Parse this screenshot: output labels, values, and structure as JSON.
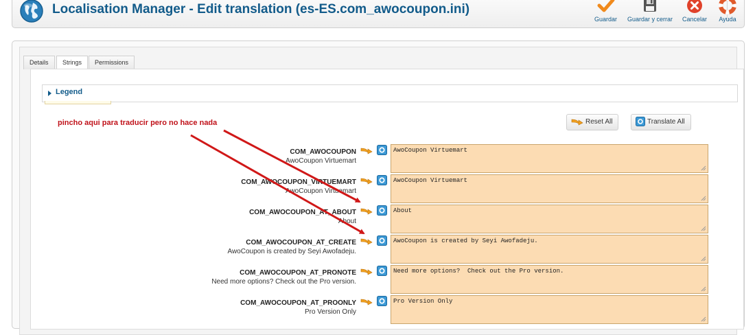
{
  "header": {
    "title": "Localisation Manager - Edit translation (es-ES.com_awocoupon.ini)",
    "logo_icon": "globe-icon"
  },
  "toolbar": {
    "save_label": "Guardar",
    "save_close_label": "Guardar y cerrar",
    "cancel_label": "Cancelar",
    "help_label": "Ayuda",
    "icons": [
      "checkmark-icon",
      "save-disk-icon",
      "cancel-x-icon",
      "help-lifebuoy-icon"
    ]
  },
  "tabs": [
    {
      "label": "Details"
    },
    {
      "label": "Strings",
      "active": true
    },
    {
      "label": "Permissions"
    }
  ],
  "legend": {
    "label": "Legend"
  },
  "annotation": "pincho aqui para traducir pero no hace nada",
  "actions": {
    "reset_all": "Reset All",
    "translate_all": "Translate All"
  },
  "colors": {
    "title": "#125b8a",
    "annotation": "#c0121a",
    "field_bg": "#fcdcb3",
    "arrow_orange": "#f0a020",
    "annotation_arrow": "#d01818"
  },
  "strings": [
    {
      "key": "COM_AWOCOUPON",
      "source": "AwoCoupon Virtuemart",
      "value": "AwoCoupon Virtuemart"
    },
    {
      "key": "COM_AWOCOUPON_VIRTUEMART",
      "source": "AwoCoupon Virtuemart",
      "value": "AwoCoupon Virtuemart"
    },
    {
      "key": "COM_AWOCOUPON_AT_ABOUT",
      "source": "About",
      "value": "About"
    },
    {
      "key": "COM_AWOCOUPON_AT_CREATE",
      "source": "AwoCoupon is created by Seyi Awofadeju.",
      "value": "AwoCoupon is created by Seyi Awofadeju."
    },
    {
      "key": "COM_AWOCOUPON_AT_PRONOTE",
      "source": "Need more options? Check out the Pro version.",
      "value": "Need more options?  Check out the Pro version."
    },
    {
      "key": "COM_AWOCOUPON_AT_PROONLY",
      "source": "Pro Version Only",
      "value": "Pro Version Only"
    }
  ]
}
